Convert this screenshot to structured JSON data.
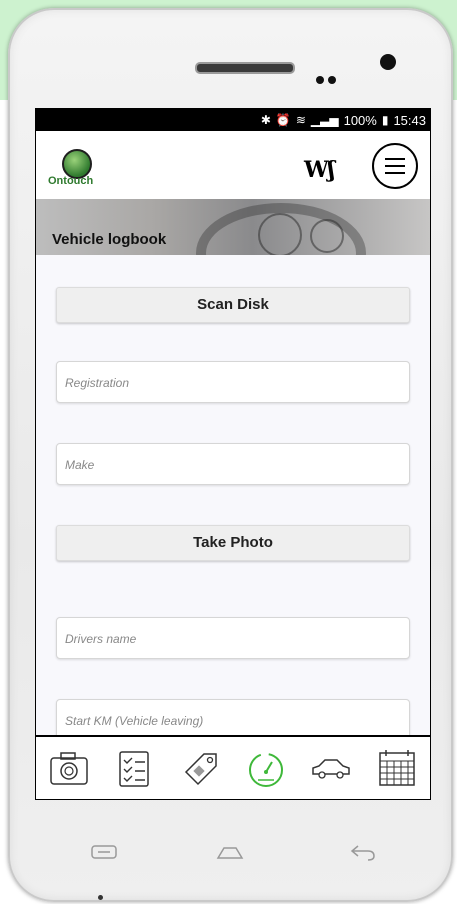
{
  "status_bar": {
    "icons": [
      "bluetooth-icon",
      "alarm-icon",
      "wifi-icon",
      "signal-icon"
    ],
    "battery": "100%",
    "time": "15:43"
  },
  "header": {
    "logo_text": "Ontouch",
    "brand_mark": "Wʃ",
    "menu_icon": "hamburger-icon"
  },
  "banner": {
    "title": "Vehicle logbook"
  },
  "form": {
    "scan_disk_label": "Scan Disk",
    "registration_placeholder": "Registration",
    "make_placeholder": "Make",
    "take_photo_label": "Take Photo",
    "drivers_name_placeholder": "Drivers name",
    "start_km_placeholder": "Start KM (Vehicle leaving)"
  },
  "tabbar": {
    "items": [
      {
        "icon": "camera-icon",
        "active": false
      },
      {
        "icon": "checklist-icon",
        "active": false
      },
      {
        "icon": "tag-icon",
        "active": false
      },
      {
        "icon": "speedometer-icon",
        "active": true
      },
      {
        "icon": "car-icon",
        "active": false
      },
      {
        "icon": "calendar-icon",
        "active": false
      }
    ]
  },
  "colors": {
    "accent_green": "#3fb83a",
    "background_accent": "#cdf2cf",
    "status_bar": "#000000"
  }
}
